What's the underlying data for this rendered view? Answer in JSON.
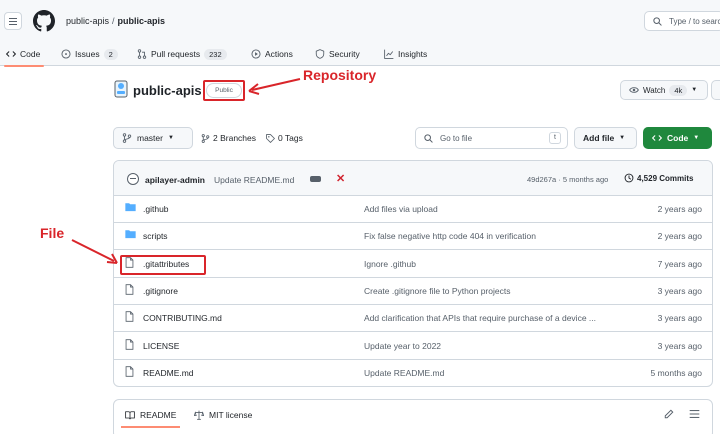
{
  "header": {
    "owner": "public-apis",
    "separator": "/",
    "repo": "public-apis",
    "search_placeholder": "Type / to search"
  },
  "tabs": [
    {
      "label": "Code",
      "icon": "code-icon",
      "active": true
    },
    {
      "label": "Issues",
      "icon": "issue-icon",
      "count": "2"
    },
    {
      "label": "Pull requests",
      "icon": "pull-request-icon",
      "count": "232"
    },
    {
      "label": "Actions",
      "icon": "actions-icon"
    },
    {
      "label": "Security",
      "icon": "shield-icon"
    },
    {
      "label": "Insights",
      "icon": "graph-icon"
    }
  ],
  "repo": {
    "name": "public-apis",
    "visibility": "Public",
    "watch_label": "Watch",
    "watch_count": "4k"
  },
  "annotations": {
    "repository": "Repository",
    "file": "File",
    "color": "#d9252a"
  },
  "toolbar": {
    "branch": "master",
    "branches": "2 Branches",
    "tags": "0 Tags",
    "go_to_file": "Go to file",
    "go_to_file_key": "t",
    "add_file": "Add file",
    "code": "Code"
  },
  "last_commit": {
    "author": "apilayer-admin",
    "message": "Update README.md",
    "hash_time": "49d267a · 5 months ago",
    "commits": "4,529 Commits"
  },
  "files": [
    {
      "type": "folder",
      "name": ".github",
      "message": "Add files via upload",
      "date": "2 years ago"
    },
    {
      "type": "folder",
      "name": "scripts",
      "message": "Fix false negative http code 404 in verification",
      "date": "2 years ago"
    },
    {
      "type": "file",
      "name": ".gitattributes",
      "message": "Ignore .github",
      "date": "7 years ago",
      "highlighted": true
    },
    {
      "type": "file",
      "name": ".gitignore",
      "message": "Create .gitignore file to Python projects",
      "date": "3 years ago"
    },
    {
      "type": "file",
      "name": "CONTRIBUTING.md",
      "message": "Add clarification that APIs that require purchase of a device ...",
      "date": "3 years ago"
    },
    {
      "type": "file",
      "name": "LICENSE",
      "message": "Update year to 2022",
      "date": "3 years ago"
    },
    {
      "type": "file",
      "name": "README.md",
      "message": "Update README.md",
      "date": "5 months ago"
    }
  ],
  "readme": {
    "tab_readme": "README",
    "tab_license": "MIT license"
  },
  "colors": {
    "accent_green": "#1f883d",
    "tab_underline": "#fd8c73",
    "folder_blue": "#54aeff",
    "muted": "#57606a"
  }
}
